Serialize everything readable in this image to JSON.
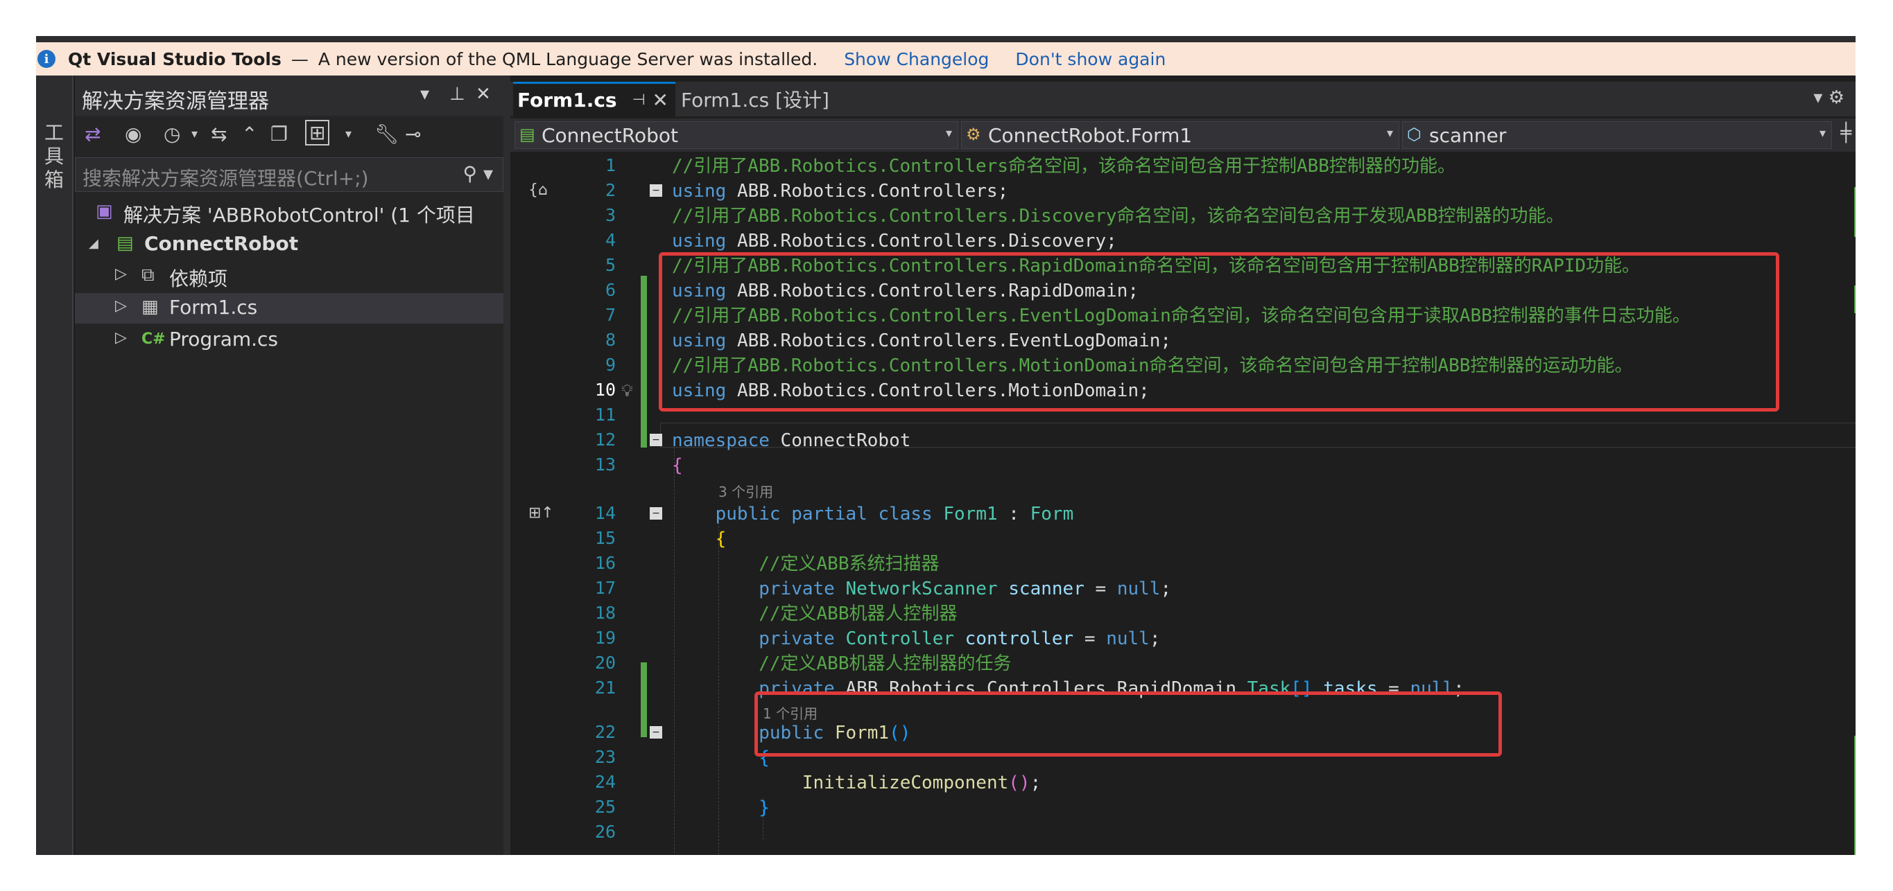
{
  "infobar": {
    "title": "Qt Visual Studio Tools",
    "dash": "—",
    "message": "A new version of the QML Language Server was installed.",
    "link1": "Show Changelog",
    "link2": "Don't show again"
  },
  "toolbox": {
    "label": "工\n具\n箱"
  },
  "solution_explorer": {
    "title": "解决方案资源管理器",
    "search_placeholder": "搜索解决方案资源管理器(Ctrl+;)",
    "solution": "解决方案 'ABBRobotControl' (1 个项目",
    "project": "ConnectRobot",
    "items": [
      {
        "label": "依赖项",
        "icon": "dependencies-icon"
      },
      {
        "label": "Form1.cs",
        "icon": "form-icon"
      },
      {
        "label": "Program.cs",
        "icon": "csharp-icon"
      }
    ]
  },
  "tabs": [
    {
      "label": "Form1.cs",
      "active": true
    },
    {
      "label": "Form1.cs [设计]",
      "active": false
    }
  ],
  "navbar": {
    "project": "ConnectRobot",
    "type": "ConnectRobot.Form1",
    "member": "scanner"
  },
  "editor": {
    "lines": [
      {
        "n": "1",
        "text": "//引用了ABB.Robotics.Controllers命名空间，该命名空间包含用于控制ABB控制器的功能。"
      },
      {
        "n": "2",
        "text": "using ABB.Robotics.Controllers;"
      },
      {
        "n": "3",
        "text": "//引用了ABB.Robotics.Controllers.Discovery命名空间，该命名空间包含用于发现ABB控制器的功能。"
      },
      {
        "n": "4",
        "text": "using ABB.Robotics.Controllers.Discovery;"
      },
      {
        "n": "5",
        "text": "//引用了ABB.Robotics.Controllers.RapidDomain命名空间，该命名空间包含用于控制ABB控制器的RAPID功能。"
      },
      {
        "n": "6",
        "text": "using ABB.Robotics.Controllers.RapidDomain;"
      },
      {
        "n": "7",
        "text": "//引用了ABB.Robotics.Controllers.EventLogDomain命名空间，该命名空间包含用于读取ABB控制器的事件日志功能。"
      },
      {
        "n": "8",
        "text": "using ABB.Robotics.Controllers.EventLogDomain;"
      },
      {
        "n": "9",
        "text": "//引用了ABB.Robotics.Controllers.MotionDomain命名空间，该命名空间包含用于控制ABB控制器的运动功能。"
      },
      {
        "n": "10",
        "text": "using ABB.Robotics.Controllers.MotionDomain;"
      },
      {
        "n": "11",
        "text": ""
      },
      {
        "n": "12",
        "text": "namespace ConnectRobot"
      },
      {
        "n": "13",
        "text": "{"
      },
      {
        "n": "14",
        "text": "    public partial class Form1 : Form"
      },
      {
        "n": "15",
        "text": "    {"
      },
      {
        "n": "16",
        "text": "        //定义ABB系统扫描器"
      },
      {
        "n": "17",
        "text": "        private NetworkScanner scanner = null;"
      },
      {
        "n": "18",
        "text": "        //定义ABB机器人控制器"
      },
      {
        "n": "19",
        "text": "        private Controller controller = null;"
      },
      {
        "n": "20",
        "text": "        //定义ABB机器人控制器的任务"
      },
      {
        "n": "21",
        "text": "        private ABB.Robotics.Controllers.RapidDomain.Task[] tasks = null;"
      },
      {
        "n": "22",
        "text": "        public Form1()"
      },
      {
        "n": "23",
        "text": "        {"
      },
      {
        "n": "24",
        "text": "            InitializeComponent();"
      },
      {
        "n": "25",
        "text": "        }"
      },
      {
        "n": "26",
        "text": ""
      }
    ],
    "hints": {
      "class_refs": "3 个引用",
      "ctor_refs": "1 个引用"
    }
  },
  "colors": {
    "comment": "#57a64a",
    "keyword": "#569cd6",
    "type": "#4ec9b0",
    "highlight_box": "#e03b3b",
    "infobar_bg": "#fbe5d6"
  }
}
